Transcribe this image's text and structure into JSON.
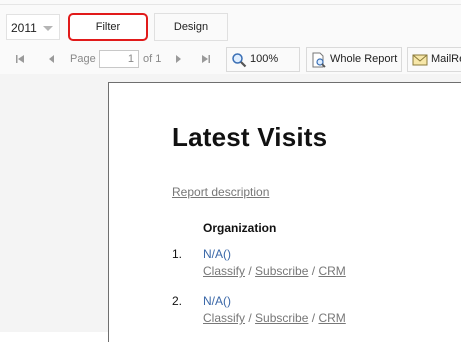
{
  "header": {
    "year": "2011",
    "tabs": [
      {
        "label": "Filter"
      },
      {
        "label": "Design"
      }
    ]
  },
  "toolbar": {
    "page_label": "Page",
    "page_value": "1",
    "of_label": "of 1",
    "zoom_label": "100%",
    "whole_report_label": "Whole Report",
    "mail_label": "MailRe"
  },
  "report": {
    "title": "Latest Visits",
    "description_link": "Report description",
    "column_header": "Organization",
    "items": [
      {
        "number": "1.",
        "name": "N/A()",
        "links": [
          "Classify",
          "Subscribe",
          "CRM"
        ]
      },
      {
        "number": "2.",
        "name": "N/A()",
        "links": [
          "Classify",
          "Subscribe",
          "CRM"
        ]
      }
    ],
    "link_separator": "/"
  },
  "colors": {
    "accent_highlight": "#e11a1a",
    "link_blue": "#3b68a8"
  }
}
